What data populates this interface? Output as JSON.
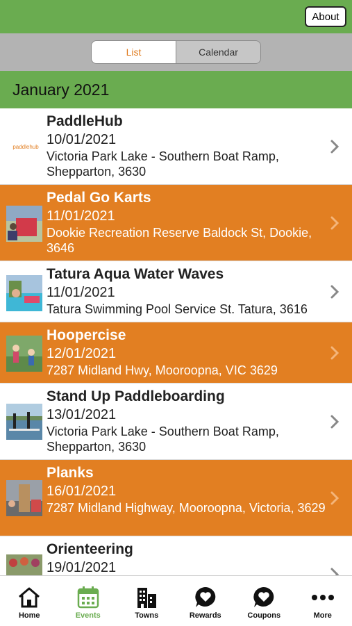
{
  "header": {
    "about_label": "About"
  },
  "segment": {
    "list_label": "List",
    "calendar_label": "Calendar"
  },
  "month_label": "January 2021",
  "events": [
    {
      "title": "PaddleHub",
      "date": "10/01/2021",
      "address": "Victoria Park Lake - Southern Boat Ramp, Shepparton, 3630",
      "logo_text": "paddlehub"
    },
    {
      "title": "Pedal Go Karts",
      "date": "11/01/2021",
      "address": "Dookie Recreation Reserve Baldock St, Dookie, 3646"
    },
    {
      "title": "Tatura Aqua Water Waves",
      "date": "11/01/2021",
      "address": "Tatura Swimming Pool Service St. Tatura, 3616"
    },
    {
      "title": "Hoopercise",
      "date": "12/01/2021",
      "address": "7287 Midland Hwy, Mooroopna, VIC 3629"
    },
    {
      "title": "Stand Up Paddleboarding",
      "date": "13/01/2021",
      "address": "Victoria Park Lake - Southern Boat Ramp, Shepparton, 3630"
    },
    {
      "title": "Planks",
      "date": "16/01/2021",
      "address": "7287 Midland Highway, Mooroopna, Victoria, 3629"
    },
    {
      "title": "Orienteering",
      "date": "19/01/2021",
      "address": ""
    }
  ],
  "tabs": [
    {
      "label": "Home",
      "icon": "home-icon"
    },
    {
      "label": "Events",
      "icon": "calendar-icon"
    },
    {
      "label": "Towns",
      "icon": "buildings-icon"
    },
    {
      "label": "Rewards",
      "icon": "heart-bubble-icon"
    },
    {
      "label": "Coupons",
      "icon": "heart-bubble-icon"
    },
    {
      "label": "More",
      "icon": "more-dots-icon"
    }
  ],
  "colors": {
    "green": "#6aac50",
    "orange": "#e27f22",
    "accent_text": "#e07b1e"
  }
}
